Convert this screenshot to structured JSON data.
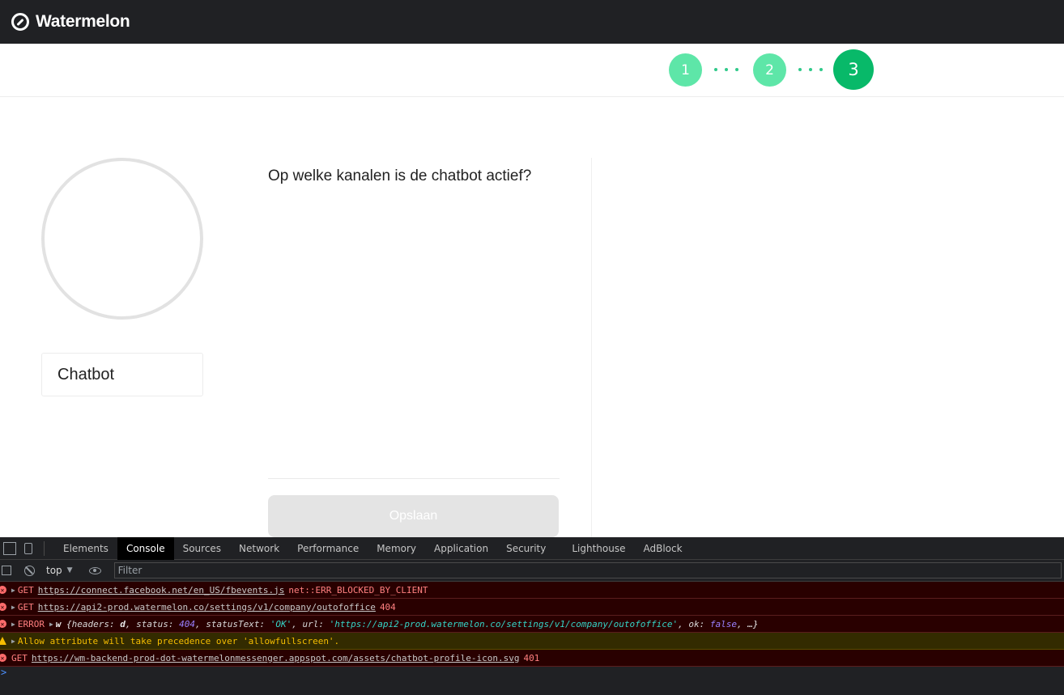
{
  "app": {
    "brand": "Watermelon",
    "logo_icon": "watermelon-logo-icon"
  },
  "stepper": {
    "steps": [
      "1",
      "2",
      "3"
    ],
    "active_step": 3,
    "colors": {
      "done": "#5ee6a8",
      "active": "#08b969"
    }
  },
  "main": {
    "avatar_icon": "avatar-placeholder",
    "name_value": "Chatbot",
    "question": "Op welke kanalen is de chatbot actief?",
    "save_label": "Opslaan"
  },
  "devtools": {
    "tabs": [
      "Elements",
      "Console",
      "Sources",
      "Network",
      "Performance",
      "Memory",
      "Application",
      "Security",
      "Lighthouse",
      "AdBlock"
    ],
    "active_tab": "Console",
    "context": "top",
    "filter_placeholder": "Filter",
    "logs": [
      {
        "level": "error",
        "method": "GET",
        "url": "https://connect.facebook.net/en_US/fbevents.js",
        "status": "net::ERR_BLOCKED_BY_CLIENT"
      },
      {
        "level": "error",
        "method": "GET",
        "url": "https://api2-prod.watermelon.co/settings/v1/company/outofoffice",
        "status": "404"
      },
      {
        "level": "error",
        "prefix": "ERROR",
        "obj": "w",
        "headers_key": "headers",
        "headers_val": "d",
        "status_key": "status",
        "status_val": "404",
        "statusText_key": "statusText",
        "statusText_val": "'OK'",
        "url_key": "url",
        "url_val": "'https://api2-prod.watermelon.co/settings/v1/company/outofoffice'",
        "ok_key": "ok",
        "ok_val": "false",
        "tail": "…}"
      },
      {
        "level": "warning",
        "text": "Allow attribute will take precedence over 'allowfullscreen'."
      },
      {
        "level": "error",
        "method": "GET",
        "url": "https://wm-backend-prod-dot-watermelonmessenger.appspot.com/assets/chatbot-profile-icon.svg",
        "status": "401"
      }
    ],
    "prompt": ">"
  }
}
